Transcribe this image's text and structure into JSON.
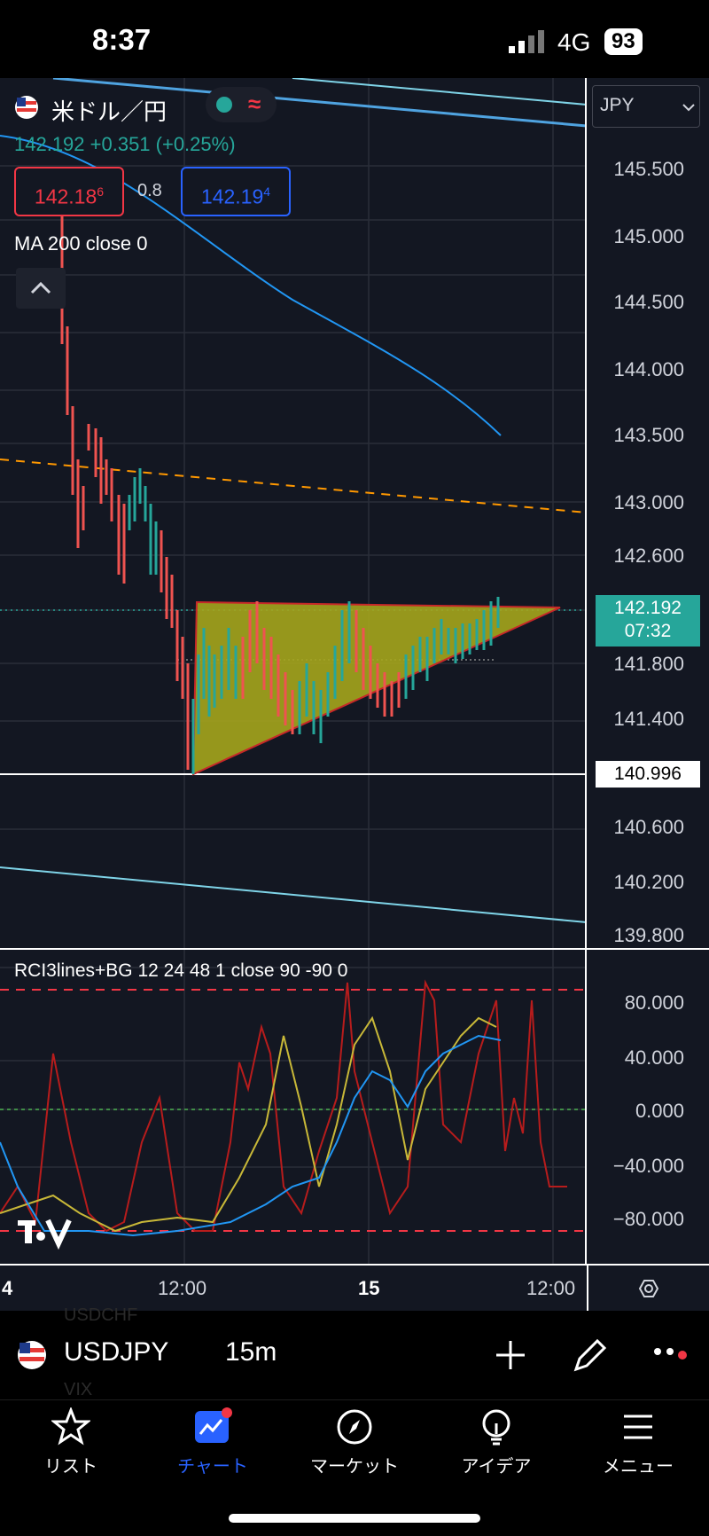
{
  "status": {
    "time": "8:37",
    "network": "4G",
    "battery": "93"
  },
  "header": {
    "flag_icon": "us-flag-icon",
    "symbol_name": "米ドル／円",
    "live_indicator": "live-dot-icon",
    "price_line": "142.192  +0.351  (+0.25%)",
    "bid": "142.18",
    "bid_sup": "6",
    "spread": "0.8",
    "ask": "142.19",
    "ask_sup": "4",
    "ma_label": "MA 200 close 0",
    "collapse_icon": "chevron-up-icon",
    "currency_select": "JPY",
    "colors": {
      "bid": "#f23645",
      "ask": "#2962ff",
      "up": "#26a69a",
      "triangle": "#a5a51c"
    }
  },
  "price_axis": {
    "ticks": [
      "145.500",
      "145.000",
      "144.500",
      "144.000",
      "143.500",
      "143.000",
      "142.600",
      "141.800",
      "141.400",
      "140.600",
      "140.200",
      "139.800"
    ],
    "current_price": "142.192",
    "countdown": "07:32",
    "marked_price": "140.996"
  },
  "indicator": {
    "label": "RCI3lines+BG 12 24 48 1 close 90 -90 0",
    "ticks": [
      "80.000",
      "40.000",
      "0.000",
      "−40.000",
      "−80.000"
    ]
  },
  "time_axis": {
    "labels": [
      "4",
      "12:00",
      "15",
      "12:00"
    ],
    "settings_icon": "hexagon-settings-icon"
  },
  "symbol_bar": {
    "symbol": "USDJPY",
    "interval": "15m",
    "ghost_top": "USDCHF",
    "ghost_bottom": "VIX",
    "add_icon": "plus-icon",
    "draw_icon": "pencil-icon",
    "more_icon": "more-dots-icon"
  },
  "tabs": [
    {
      "label": "リスト",
      "icon": "star-icon"
    },
    {
      "label": "チャート",
      "icon": "chart-icon"
    },
    {
      "label": "マーケット",
      "icon": "compass-icon"
    },
    {
      "label": "アイデア",
      "icon": "lightbulb-icon"
    },
    {
      "label": "メニュー",
      "icon": "hamburger-icon"
    }
  ]
}
